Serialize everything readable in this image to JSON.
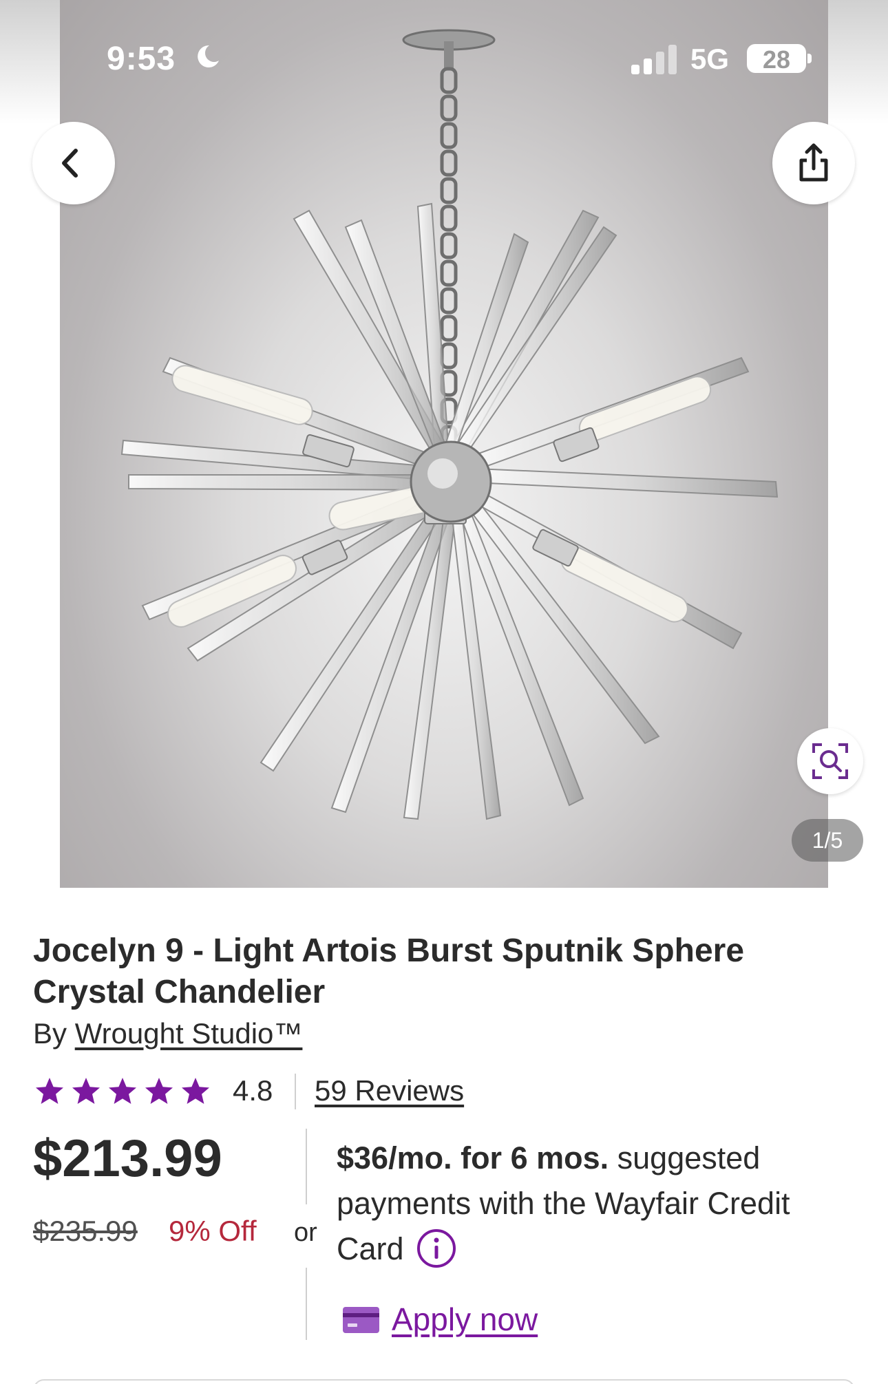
{
  "status_bar": {
    "time": "9:53",
    "network": "5G",
    "battery": "28"
  },
  "gallery": {
    "counter": "1/5",
    "image_alt": "Crystal sputnik chandelier"
  },
  "product": {
    "title": "Jocelyn 9 - Light Artois Burst Sputnik Sphere Crystal Chandelier",
    "by_prefix": "By",
    "brand": "Wrought Studio™",
    "rating": "4.8",
    "stars": 5,
    "reviews_label": "59 Reviews",
    "price": "$213.99",
    "old_price": "$235.99",
    "discount": "9% Off",
    "or_label": "or",
    "financing": {
      "bold": "$36/mo. for 6 mos.",
      "line1_rest": " suggested",
      "line2": "payments with the Wayfair Credit",
      "line3": "Card",
      "apply_label": "Apply now"
    }
  },
  "colors": {
    "star": "#7b189f",
    "link": "#7b189f",
    "discount": "#b5283c",
    "text": "#2b2b2b"
  }
}
